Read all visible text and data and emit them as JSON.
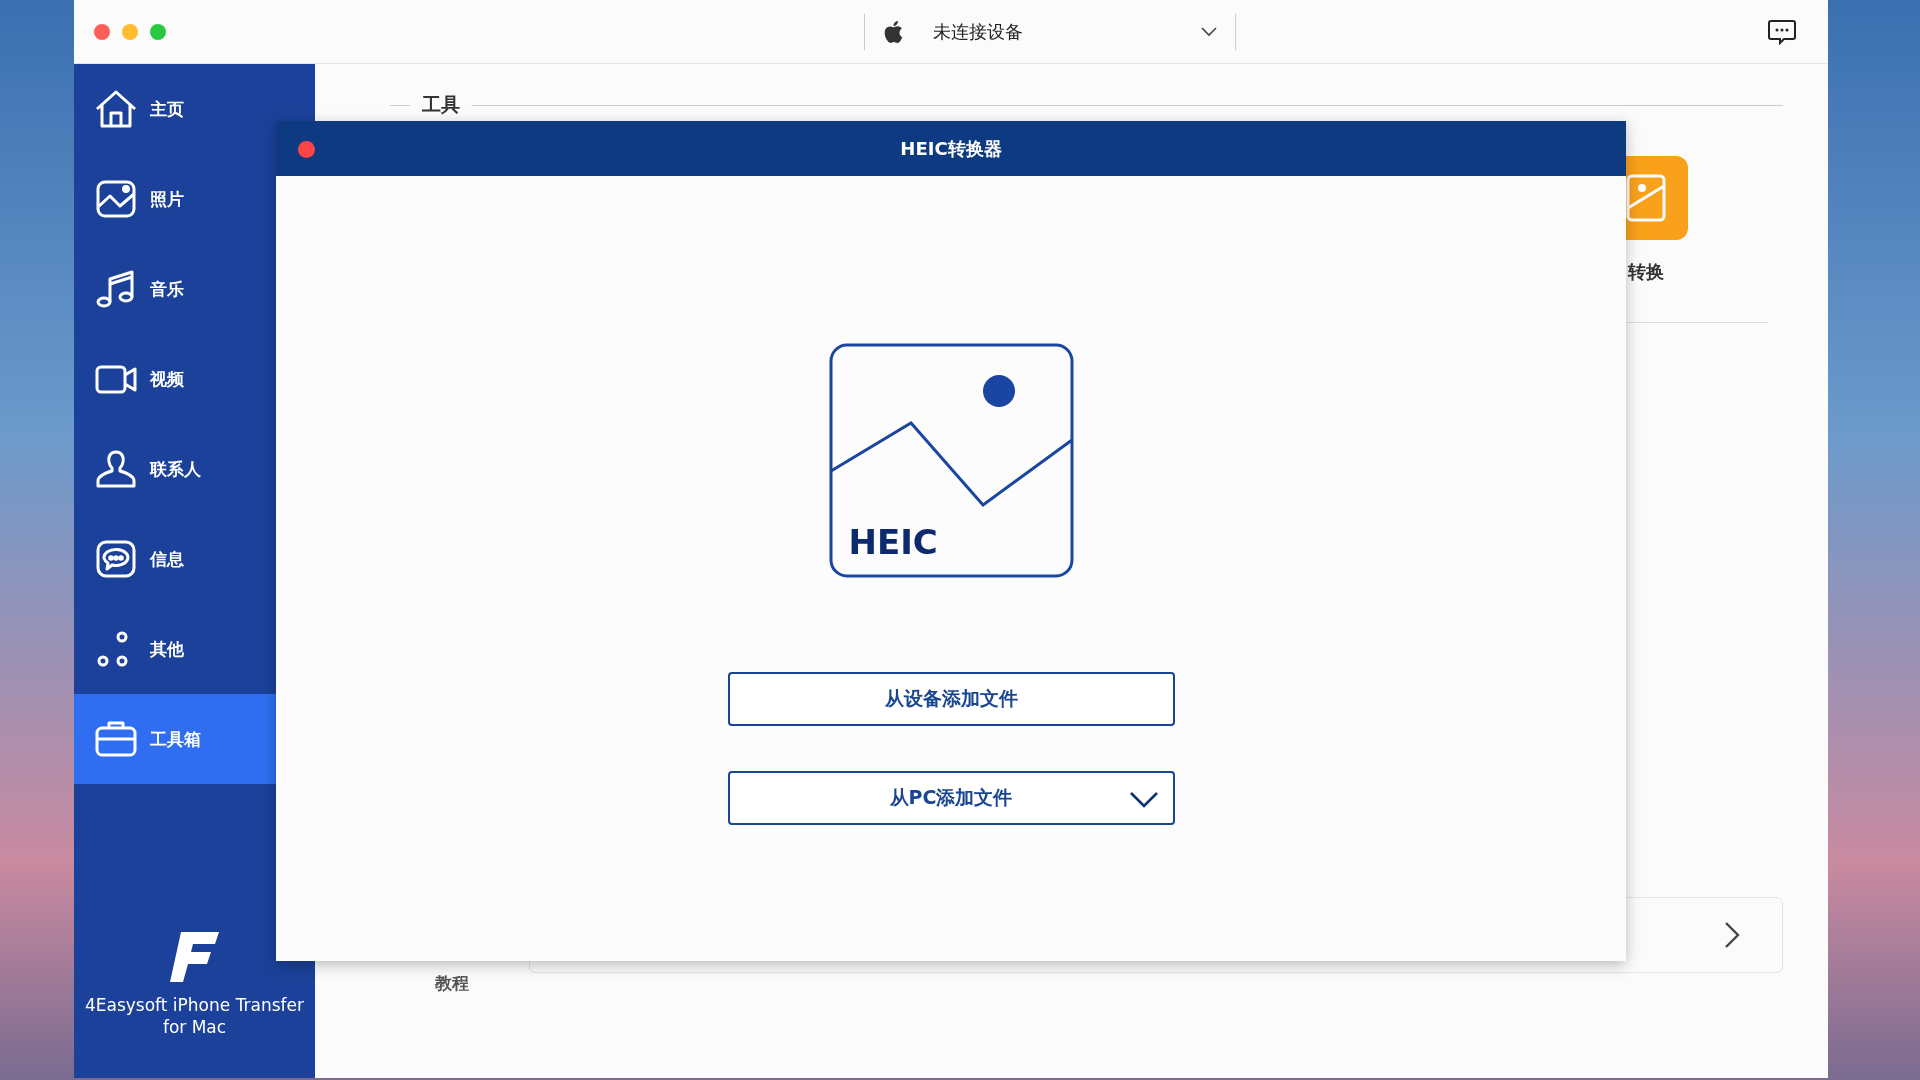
{
  "device_selector": {
    "label": "未连接设备"
  },
  "sidebar": {
    "items": [
      {
        "label": "主页",
        "kind": "home",
        "selected": false
      },
      {
        "label": "照片",
        "kind": "photo",
        "selected": false
      },
      {
        "label": "音乐",
        "kind": "music",
        "selected": false
      },
      {
        "label": "视频",
        "kind": "video",
        "selected": false
      },
      {
        "label": "联系人",
        "kind": "contact",
        "selected": false
      },
      {
        "label": "信息",
        "kind": "message",
        "selected": false
      },
      {
        "label": "其他",
        "kind": "other",
        "selected": false
      },
      {
        "label": "工具箱",
        "kind": "toolbox",
        "selected": true
      }
    ],
    "app_name": "4Easysoft iPhone Transfer for Mac"
  },
  "main": {
    "section_title": "工具",
    "tool_label": "转换",
    "tutorial_label": "教程"
  },
  "dialog": {
    "title": "HEIC转换器",
    "image_label": "HEIC",
    "buttons": [
      {
        "label": "从设备添加文件",
        "kind": "plain"
      },
      {
        "label": "从PC添加文件",
        "kind": "dropdown"
      }
    ]
  }
}
